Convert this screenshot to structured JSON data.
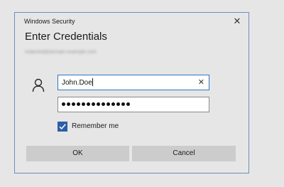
{
  "window": {
    "title": "Windows Security",
    "close_glyph": "✕"
  },
  "dialog": {
    "heading": "Enter Credentials",
    "account_hint": "redacted@domain.example.com"
  },
  "username": {
    "value": "John.Doe",
    "clear_glyph": "✕",
    "icon": "user-icon"
  },
  "password": {
    "masked_length": 14
  },
  "remember": {
    "label": "Remember me",
    "checked": true
  },
  "buttons": {
    "ok_label": "OK",
    "cancel_label": "Cancel"
  },
  "colors": {
    "accent": "#2f74c6",
    "checkbox_fill": "#2b5fa8",
    "window_border": "#6b8fbd",
    "button_bg": "#cccccc",
    "dialog_bg": "#e6e6e6"
  }
}
